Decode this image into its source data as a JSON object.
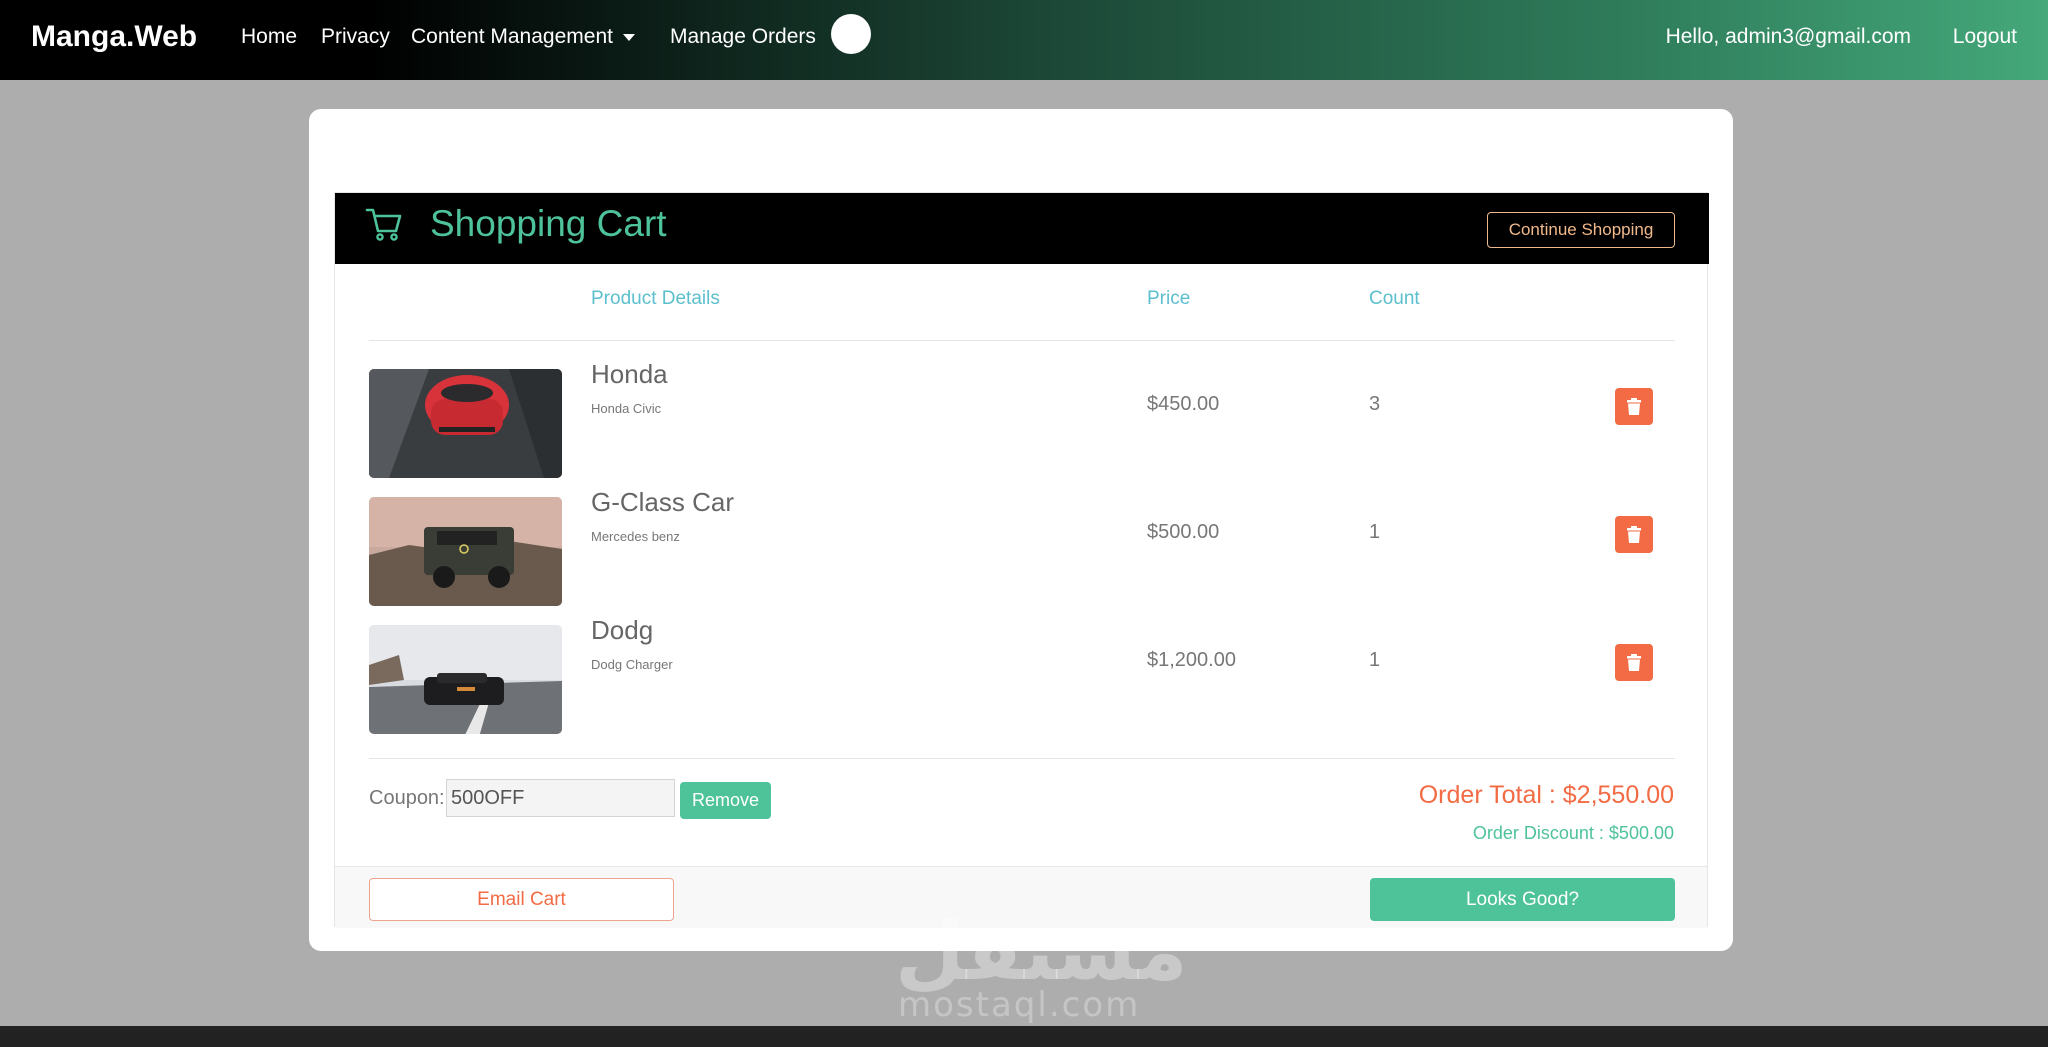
{
  "nav": {
    "brand": "Manga.Web",
    "links": [
      "Home",
      "Privacy",
      "Content Management",
      "Manage Orders"
    ],
    "greeting": "Hello, admin3@gmail.com",
    "logout": "Logout"
  },
  "cart": {
    "title": "Shopping Cart",
    "continue_label": "Continue Shopping",
    "columns": {
      "details": "Product Details",
      "price": "Price",
      "count": "Count"
    },
    "items": [
      {
        "name": "Honda",
        "desc": "Honda Civic",
        "price": "$450.00",
        "count": "3"
      },
      {
        "name": "G-Class Car",
        "desc": "Mercedes benz",
        "price": "$500.00",
        "count": "1"
      },
      {
        "name": "Dodg",
        "desc": "Dodg Charger",
        "price": "$1,200.00",
        "count": "1"
      }
    ],
    "coupon_label": "Coupon:",
    "coupon_value": "500OFF",
    "remove_label": "Remove",
    "order_total": "Order Total : $2,550.00",
    "order_discount": "Order Discount : $500.00",
    "email_label": "Email Cart",
    "confirm_label": "Looks Good?"
  },
  "watermark": {
    "arabic": "مستقل",
    "latin": "mostaql.com"
  },
  "colors": {
    "accent": "#4ec39a",
    "danger": "#f26b44",
    "header_bg": "#000000",
    "column_head": "#5bbfcd"
  }
}
